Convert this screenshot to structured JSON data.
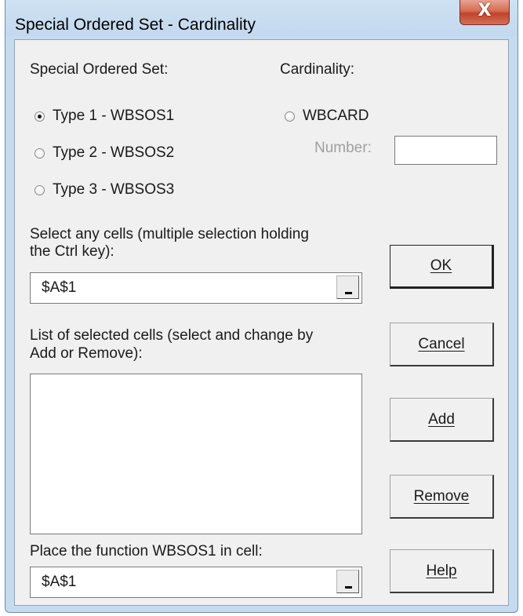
{
  "window": {
    "title": "Special Ordered Set - Cardinality",
    "close_label": "X"
  },
  "sos": {
    "heading": "Special Ordered Set:",
    "options": [
      {
        "label": "Type 1 - WBSOS1",
        "selected": true
      },
      {
        "label": "Type 2 - WBSOS2",
        "selected": false
      },
      {
        "label": "Type 3 - WBSOS3",
        "selected": false
      }
    ]
  },
  "cardinality": {
    "heading": "Cardinality:",
    "option_label": "WBCARD",
    "selected": false,
    "number_label": "Number:",
    "number_value": ""
  },
  "select_cells": {
    "label_line1": "Select any cells (multiple selection holding",
    "label_line2": "the Ctrl key):",
    "value": "$A$1"
  },
  "list_cells": {
    "label_line1": "List of selected cells (select and change by",
    "label_line2": "Add or Remove):",
    "items": []
  },
  "place_function": {
    "label": "Place the function WBSOS1 in cell:",
    "value": "$A$1"
  },
  "buttons": {
    "ok": "OK",
    "cancel": "Cancel",
    "add": "Add",
    "remove": "Remove",
    "help": "Help"
  }
}
